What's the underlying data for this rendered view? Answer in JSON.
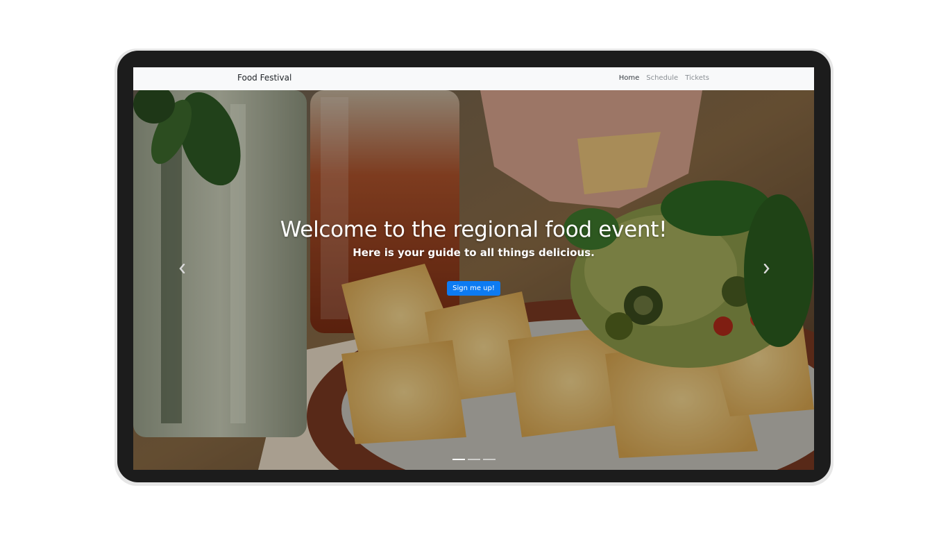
{
  "navbar": {
    "brand": "Food Festival",
    "links": [
      "Home",
      "Schedule",
      "Tickets"
    ],
    "active_index": 0
  },
  "hero": {
    "heading": "Welcome to the regional food event!",
    "subheading": "Here is your guide to all things delicious.",
    "cta_label": "Sign me up!",
    "prev_icon": "chevron-left-icon",
    "next_icon": "chevron-right-icon",
    "slide_count": 3,
    "active_slide": 0
  },
  "colors": {
    "navbar_bg": "#f8f9fa",
    "button": "#0d7bf2",
    "device_frame": "#1c1c1c"
  }
}
